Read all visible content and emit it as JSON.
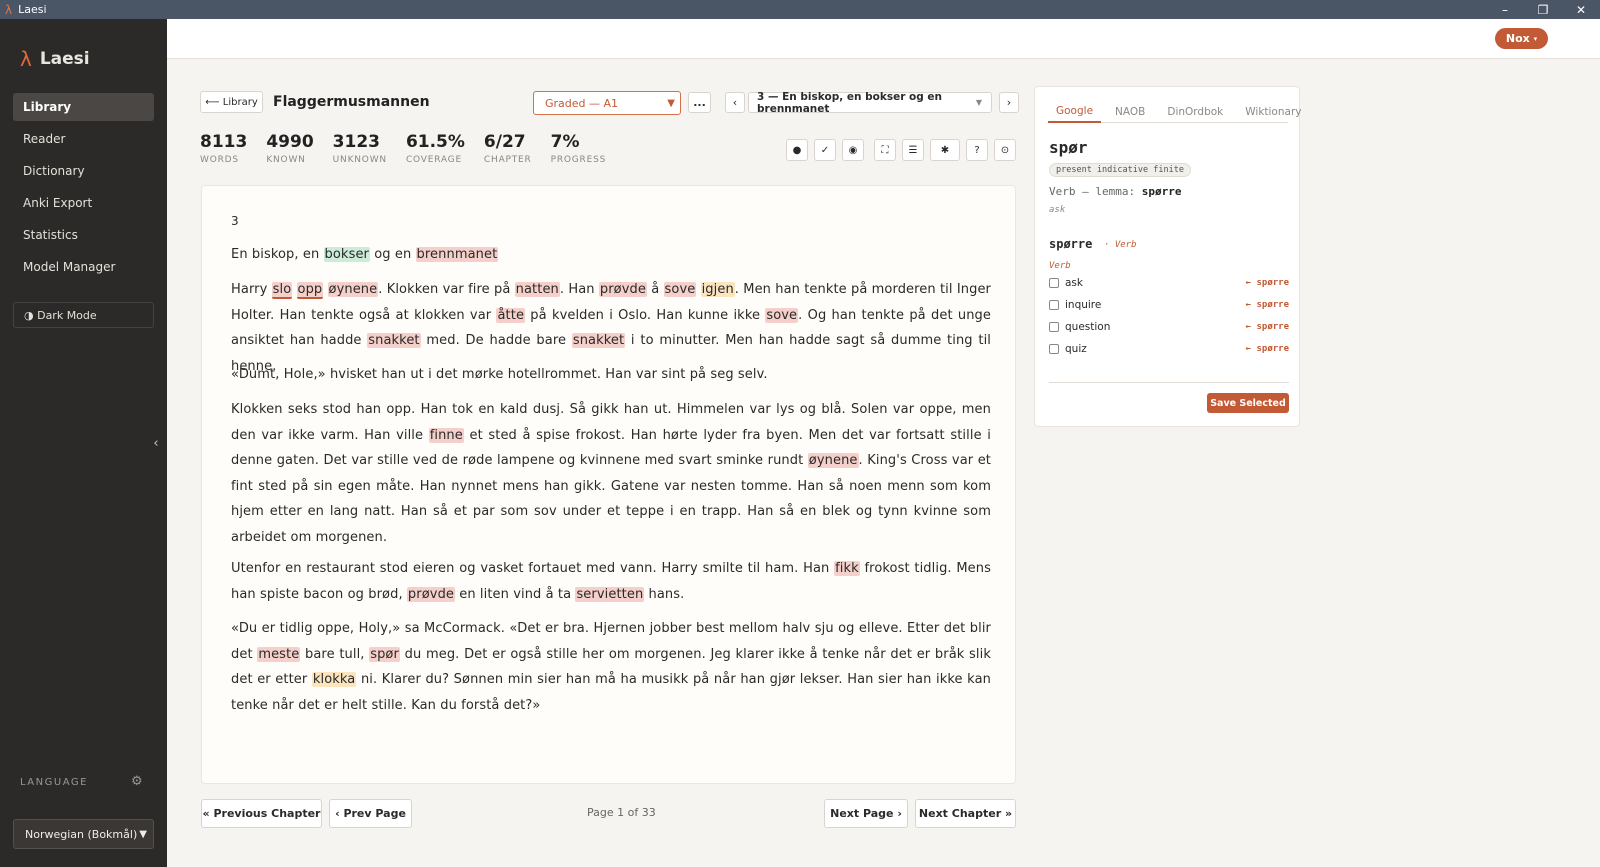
{
  "window": {
    "title": "Laesi",
    "controls": {
      "minimize": "–",
      "restore": "❐",
      "close": "✕"
    }
  },
  "sidebar": {
    "brand": "Laesi",
    "items": [
      {
        "label": "Library"
      },
      {
        "label": "Reader"
      },
      {
        "label": "Dictionary"
      },
      {
        "label": "Anki Export"
      },
      {
        "label": "Statistics"
      },
      {
        "label": "Model Manager"
      }
    ],
    "dark_mode": "◑ Dark Mode",
    "collapse": "‹",
    "language_label": "LANGUAGE",
    "language_value": "Norwegian (Bokmål)"
  },
  "topbar": {
    "user_label": "Nox",
    "user_chevron": "▾"
  },
  "header": {
    "library_button": "⟵ Library",
    "book_title": "Flaggermusmannen",
    "level": "Graded — A1",
    "more": "...",
    "prev_chapter": "‹",
    "next_chapter": "›",
    "chapter_select": "3 — En biskop, en bokser og en brennmanet"
  },
  "stats": [
    {
      "value": "8113",
      "label": "WORDS"
    },
    {
      "value": "4990",
      "label": "KNOWN"
    },
    {
      "value": "3123",
      "label": "UNKNOWN"
    },
    {
      "value": "61.5%",
      "label": "COVERAGE"
    },
    {
      "value": "6/27",
      "label": "CHAPTER"
    },
    {
      "value": "7%",
      "label": "PROGRESS"
    }
  ],
  "tools": [
    "●",
    "✓",
    "◉",
    "⛶",
    "☰",
    "✱",
    "?",
    "⊙"
  ],
  "reader": {
    "chapter_number": "3",
    "paragraphs": [
      [
        [
          "En biskop, en ",
          ""
        ],
        [
          "bokser",
          "green"
        ],
        [
          " og en ",
          ""
        ],
        [
          "brennmanet",
          "red"
        ]
      ],
      [
        [
          "Harry ",
          ""
        ],
        [
          "slo",
          "under"
        ],
        [
          " ",
          ""
        ],
        [
          "opp",
          "under"
        ],
        [
          " ",
          ""
        ],
        [
          "øynene",
          "red"
        ],
        [
          ". Klokken var fire på ",
          ""
        ],
        [
          "natten",
          "red"
        ],
        [
          ". Han ",
          ""
        ],
        [
          "prøvde",
          "red"
        ],
        [
          " å ",
          ""
        ],
        [
          "sove",
          "red"
        ],
        [
          " ",
          ""
        ],
        [
          "igjen",
          "yellow"
        ],
        [
          ". Men han tenkte på morderen til Inger Holter. Han tenkte også at klokken var ",
          ""
        ],
        [
          "åtte",
          "red"
        ],
        [
          " på kvelden i Oslo. Han kunne ikke ",
          ""
        ],
        [
          "sove",
          "red"
        ],
        [
          ". Og han tenkte på det unge an­siktet han hadde ",
          ""
        ],
        [
          "snakket",
          "red"
        ],
        [
          " med. De hadde bare ",
          ""
        ],
        [
          "snakket",
          "red"
        ],
        [
          " i to minutter. Men han hadde sagt så dumme ting til henne.",
          ""
        ]
      ],
      [
        [
          "«Dumt, Hole,» hvisket han ut i det mørke hotellrommet. Han var sint på seg selv.",
          ""
        ]
      ],
      [
        [
          "Klokken seks stod han opp. Han tok en kald dusj. Så gikk han ut. Himmelen var lys og blå. Solen var oppe, men den var ikke varm. Han ville ",
          ""
        ],
        [
          "finne",
          "red"
        ],
        [
          " et sted å spise frokost. Han hørte lyder fra byen. Men det var fortsatt stille i denne gaten. Det var stille ved de røde lampene og kvinnene med svart sminke rundt ",
          ""
        ],
        [
          "øynene",
          "red"
        ],
        [
          ". King's Cross var et fint sted på sin egen måte. Han nynnet mens han gikk. Gatene var nesten tomme. Han så noen menn som kom hjem etter en lang natt. Han så et par som sov under et teppe i en trapp. Han så en blek og tynn kvinne som arbeidet om morgenen.",
          ""
        ]
      ],
      [
        [
          "Utenfor en restaurant stod eieren og vasket fortauet med vann. Harry smilte til ham. Han ",
          ""
        ],
        [
          "fikk",
          "red"
        ],
        [
          " frokost tidlig. Mens han spiste bacon og brød, ",
          ""
        ],
        [
          "prøvde",
          "red"
        ],
        [
          " en liten vind å ta ",
          ""
        ],
        [
          "servietten",
          "red"
        ],
        [
          " hans.",
          ""
        ]
      ],
      [
        [
          "«Du er tidlig oppe, Holy,» sa McCormack. «Det er bra. Hjernen jobber best mellom halv sju og elleve. Etter det blir det ",
          ""
        ],
        [
          "meste",
          "red"
        ],
        [
          " bare tull, ",
          ""
        ],
        [
          "spør",
          "red"
        ],
        [
          " du meg. Det er også stille her om morgenen. Jeg klarer ikke å tenke når det er bråk slik det er etter ",
          ""
        ],
        [
          "klokka",
          "yellow"
        ],
        [
          " ni. Klarer du? Sønnen min sier han må ha musikk på når han gjør lekser. Han sier han ikke kan tenke når det er helt stille. Kan du forstå det?»",
          ""
        ]
      ]
    ]
  },
  "pagination": {
    "previous_chapter": "« Previous Chapter",
    "prev_page": "‹ Prev Page",
    "page_info": "Page 1 of 33",
    "next_page": "Next Page ›",
    "next_chapter": "Next Chapter »"
  },
  "dictionary": {
    "tabs": [
      "Google",
      "NAOB",
      "DinOrdbok",
      "Wiktionary"
    ],
    "headword": "spør",
    "badge": "present indicative finite",
    "pos_prefix": "Verb — lemma: ",
    "pos_lemma": "spørre",
    "gloss": "ask",
    "lemma": "spørre",
    "lemma_pos": "· Verb",
    "sense_pos": "Verb",
    "definitions": [
      {
        "text": "ask",
        "source": "← spørre"
      },
      {
        "text": "inquire",
        "source": "← spørre"
      },
      {
        "text": "question",
        "source": "← spørre"
      },
      {
        "text": "quiz",
        "source": "← spørre"
      }
    ],
    "save_button": "Save Selected"
  },
  "colors": {
    "accent": "#c25a35",
    "sidebar": "#2c2a28",
    "titlebar": "#4a5565",
    "unknown": "#f5cfc9",
    "learning": "#fbe5bf",
    "known": "#cdebd9"
  }
}
